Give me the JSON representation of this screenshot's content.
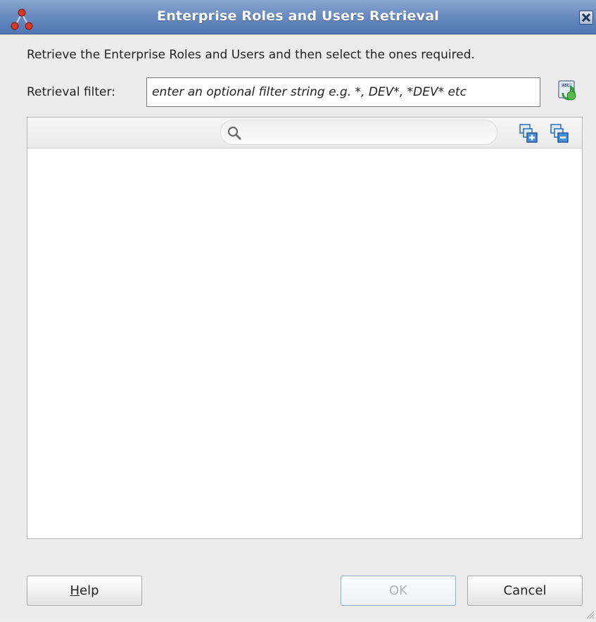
{
  "window": {
    "title": "Enterprise Roles and Users Retrieval",
    "app_icon": "jdeveloper-hierarchy-icon",
    "close_icon": "close-icon"
  },
  "instructions": "Retrieve the Enterprise Roles and Users and then select the ones required.",
  "filter": {
    "label": "Retrieval filter:",
    "value": "",
    "placeholder": "enter an optional filter string e.g. *, DEV*, *DEV* etc",
    "retrieve_icon": "retrieve-users-icon"
  },
  "tree_panel": {
    "search": {
      "value": "",
      "placeholder": "",
      "icon": "search-icon"
    },
    "expand_all_icon": "expand-all-icon",
    "collapse_all_icon": "collapse-all-icon",
    "items": []
  },
  "buttons": {
    "help_mnemonic": "H",
    "help_rest": "elp",
    "ok_label": "OK",
    "ok_enabled": false,
    "cancel_label": "Cancel"
  },
  "colors": {
    "titlebar": "#5f84bd",
    "ok_border": "#8fb0d6"
  }
}
